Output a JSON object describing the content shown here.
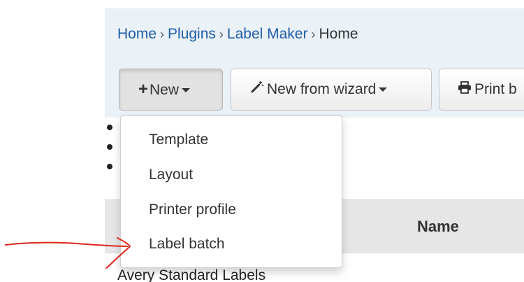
{
  "breadcrumb": {
    "items": [
      "Home",
      "Plugins",
      "Label Maker",
      "Home"
    ],
    "separator": "›"
  },
  "toolbar": {
    "new_label": "New",
    "wizard_label": "New from wizard",
    "print_label": "Print b"
  },
  "dropdown": {
    "items": [
      "Template",
      "Layout",
      "Printer profile",
      "Label batch"
    ]
  },
  "table": {
    "header_name": "Name",
    "first_row_name": "Avery Standard Labels"
  },
  "colors": {
    "breadcrumb_bg": "#eaf1f7",
    "link": "#1f5da6",
    "annotation": "#e0261c"
  },
  "icons": {
    "new": "plus-icon",
    "wizard": "magic-wand-icon",
    "print": "printer-icon"
  }
}
